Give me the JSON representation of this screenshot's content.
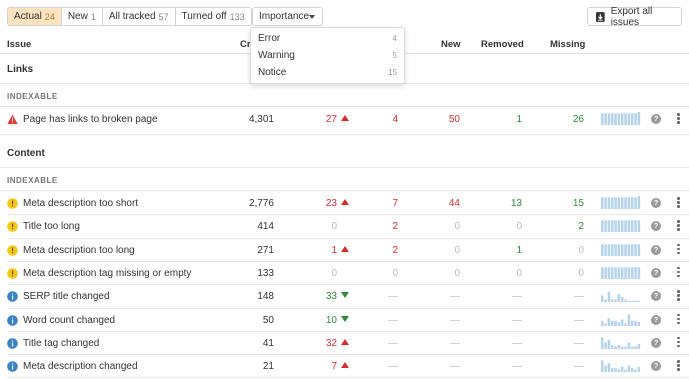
{
  "toolbar": {
    "tabs": [
      {
        "label": "Actual",
        "count": "24"
      },
      {
        "label": "New",
        "count": "1"
      },
      {
        "label": "All tracked",
        "count": "57"
      },
      {
        "label": "Turned off",
        "count": "133"
      }
    ],
    "importance_label": "Importance",
    "export_label": "Export all issues"
  },
  "columns": {
    "issue": "Issue",
    "crawled": "Cra",
    "new": "New",
    "removed": "Removed",
    "missing": "Missing"
  },
  "dropdown": {
    "items": [
      {
        "label": "Error",
        "count": "4"
      },
      {
        "label": "Warning",
        "count": "5"
      },
      {
        "label": "Notice",
        "count": "15"
      }
    ]
  },
  "sections": [
    {
      "title": "Links",
      "subhead": "INDEXABLE",
      "rows": [
        {
          "icon": "error-icon",
          "name": "Page has links to broken page",
          "crawled": "4,301",
          "change": "27",
          "dir": "up",
          "added": "4",
          "new": "50",
          "removed": "1",
          "missing": "26",
          "spark": [
            9,
            9,
            9,
            9,
            9,
            9,
            9,
            9,
            9,
            9,
            9,
            10
          ]
        }
      ]
    },
    {
      "title": "Content",
      "subhead": "INDEXABLE",
      "rows": [
        {
          "icon": "warning-icon",
          "name": "Meta description too short",
          "crawled": "2,776",
          "change": "23",
          "dir": "up",
          "added": "7",
          "new": "44",
          "removed": "13",
          "missing": "15",
          "spark": [
            9,
            9,
            9,
            9,
            9,
            9,
            9,
            9,
            9,
            9,
            9,
            10
          ]
        },
        {
          "icon": "warning-icon",
          "name": "Title too long",
          "crawled": "414",
          "change": "0",
          "dir": "",
          "added": "2",
          "new": "0",
          "removed": "0",
          "missing": "2",
          "spark": [
            9,
            9,
            9,
            9,
            9,
            9,
            9,
            9,
            9,
            9,
            9,
            9
          ]
        },
        {
          "icon": "warning-icon",
          "name": "Meta description too long",
          "crawled": "271",
          "change": "1",
          "dir": "up",
          "added": "2",
          "new": "0",
          "removed": "1",
          "missing": "0",
          "spark": [
            9,
            9,
            9,
            9,
            9,
            9,
            9,
            9,
            9,
            9,
            9,
            9
          ]
        },
        {
          "icon": "warning-icon",
          "name": "Meta description tag missing or empty",
          "crawled": "133",
          "change": "0",
          "dir": "",
          "added": "0",
          "new": "0",
          "removed": "0",
          "missing": "0",
          "spark": [
            9,
            9,
            9,
            9,
            9,
            9,
            9,
            9,
            9,
            9,
            9,
            9
          ]
        },
        {
          "icon": "notice-icon",
          "name": "SERP title changed",
          "crawled": "148",
          "change": "33",
          "dir": "down",
          "added": "—",
          "new": "—",
          "removed": "—",
          "missing": "—",
          "spark": [
            5,
            2,
            8,
            2,
            2,
            6,
            4,
            2,
            1,
            1,
            1,
            1
          ]
        },
        {
          "icon": "notice-icon",
          "name": "Word count changed",
          "crawled": "50",
          "change": "10",
          "dir": "down",
          "added": "—",
          "new": "—",
          "removed": "—",
          "missing": "—",
          "spark": [
            4,
            2,
            6,
            4,
            4,
            3,
            5,
            2,
            9,
            4,
            4,
            3
          ]
        },
        {
          "icon": "notice-icon",
          "name": "Title tag changed",
          "crawled": "41",
          "change": "32",
          "dir": "up",
          "added": "—",
          "new": "—",
          "removed": "—",
          "missing": "—",
          "spark": [
            9,
            5,
            7,
            3,
            2,
            3,
            2,
            2,
            5,
            2,
            2,
            4
          ]
        },
        {
          "icon": "notice-icon",
          "name": "Meta description changed",
          "crawled": "21",
          "change": "7",
          "dir": "up",
          "added": "—",
          "new": "—",
          "removed": "—",
          "missing": "—",
          "spark": [
            9,
            5,
            7,
            3,
            3,
            2,
            4,
            2,
            5,
            3,
            2,
            4
          ]
        }
      ]
    }
  ],
  "colors": {
    "error": "#e53935",
    "warning": "#f5c518",
    "notice": "#3b82c4",
    "red": "#d32f2f",
    "green": "#2e8b3a",
    "spark_bar": "#b5d3ec",
    "active_tab": "#fde3bf"
  }
}
